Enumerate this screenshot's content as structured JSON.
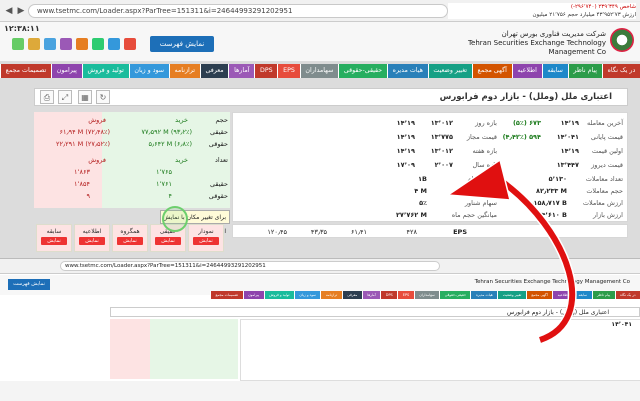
{
  "browser": {
    "url": "www.tsetmc.com/Loader.aspx?ParTree=151311&i=24644993291202951",
    "back_icon": "back-arrow-icon",
    "forward_icon": "forward-arrow-icon"
  },
  "ticker": {
    "line1": "شاخص ۲۳۹٬۳۴۹ (۲۹۶٬۷۴۰-)",
    "line2": "ارزش ۴۳٬۹۵۲٬۷۳ میلیارد  حجم ۲۱٬۷۵۶ میلیون",
    "time": "۱۲:۳۸:۱۱"
  },
  "header": {
    "company_fa": "شرکت مدیریت فناوری بورس تهران",
    "company_en": "Tehran Securities Exchange Technology Management Co",
    "show_list_label": "نمایش فهرست"
  },
  "menu": [
    {
      "label": "در یک نگاه",
      "color": "#c0392b"
    },
    {
      "label": "پیام ناظر",
      "color": "#2c9c4a"
    },
    {
      "label": "سابقه",
      "color": "#1e88c9"
    },
    {
      "label": "اطلاعیه",
      "color": "#8e44ad"
    },
    {
      "label": "آگهی مجمع",
      "color": "#d35400"
    },
    {
      "label": "تغییر وضعیت",
      "color": "#16a085"
    },
    {
      "label": "هیات مدیره",
      "color": "#2980b9"
    },
    {
      "label": "حقیقی-حقوقی",
      "color": "#27ae60"
    },
    {
      "label": "سهامداران",
      "color": "#7f8c8d"
    },
    {
      "label": "EPS",
      "color": "#e74c3c"
    },
    {
      "label": "DPS",
      "color": "#c0392b"
    },
    {
      "label": "آمارها",
      "color": "#9b59b6"
    },
    {
      "label": "معرفی",
      "color": "#2c3e50"
    },
    {
      "label": "ترازنامه",
      "color": "#e67e22"
    },
    {
      "label": "سود و زیان",
      "color": "#3498db"
    },
    {
      "label": "تولید و فروش",
      "color": "#1abc9c"
    },
    {
      "label": "پیرامون",
      "color": "#8e44ad"
    },
    {
      "label": "تصمیمات مجمع",
      "color": "#c0392b"
    }
  ],
  "title": "اعتباری ملل (وملل) - بازار دوم فرابورس",
  "stats_right": [
    {
      "label": "آخرین معامله",
      "value": "۱۴٬۱۹",
      "change": "(۵٪) ۶۷۳"
    },
    {
      "label": "قیمت پایانی",
      "value": "۱۴٬۰۴۱",
      "change": "(۴٫۴۲٪) ۵۹۴"
    },
    {
      "label": "اولین قیمت",
      "value": "۱۴٬۱۹"
    },
    {
      "label": "قیمت دیروز",
      "value": "۱۳٬۴۴۷"
    }
  ],
  "stats_mid": [
    {
      "label": "بازه روز",
      "v1": "۱۳٬۰۱۲",
      "v2": "۱۴٬۱۹"
    },
    {
      "label": "قیمت مجاز",
      "v1": "۱۳٬۷۷۵",
      "v2": "۱۴٬۱۹"
    },
    {
      "label": "بازه هفته",
      "v1": "۱۳٬۰۱۲",
      "v2": "۱۴٬۱۹"
    },
    {
      "label": "بازه سال",
      "v1": "۲٬۰۰۷",
      "v2": "۱۷٬۰۹"
    }
  ],
  "stats_counts": [
    {
      "label": "تعداد معاملات",
      "value": "۵٬۱۳۰"
    },
    {
      "label": "حجم معاملات",
      "value": "۸۲٫۲۳۳ M"
    },
    {
      "label": "ارزش معاملات",
      "value": "۱٫۱۵۸٫۷۱۷ B"
    },
    {
      "label": "ارزش بازار",
      "value": "۲۴٬۶۱۰ B"
    }
  ],
  "stats_shares": [
    {
      "label": "تعداد سهام",
      "value": "۱B"
    },
    {
      "label": "حجم مبنا",
      "value": "۴ M"
    },
    {
      "label": "سهام شناور",
      "value": "۵٪"
    },
    {
      "label": "میانگین حجم ماه",
      "value": "۲۷٬۷۶۲ M"
    }
  ],
  "eps": {
    "label": "EPS",
    "v1": "۴۲۸",
    "v2": "۶۱٫۴۱",
    "v3": "۴۳٫۳۵",
    "v4": "۱۲۰٫۴۵"
  },
  "buysell": {
    "sell_label": "فروش",
    "buy_label": "خرید",
    "volume_label": "حجم",
    "real_label": "حقیقی",
    "legal_label": "حقوقی",
    "row1_sell": "۶۱٫۹۴ M (۷۲٫۴۸٪)",
    "row1_buy": "۷۷٫۵۹۲ M (۹۳٫۲٪)",
    "row2_sell": "۲۲٫۲۹۱ M (۲۷٫۵۲٪)",
    "row2_buy": "۵٫۶۴۲ M (۶٫۸٪)",
    "count_label": "تعداد",
    "count_buy": "۱٬۷۶۵",
    "count_sell": "۱٬۸۶۳",
    "count_buy2": "۱٬۷۶۱",
    "count_sell2": "۱٬۸۵۴",
    "count_buy3": "۴",
    "count_sell3": "۹"
  },
  "tooltip": "برای تغییر مکان با نمایش اطلاعات",
  "bottom_buttons": [
    {
      "label": "سابقه",
      "btn": "نمایش"
    },
    {
      "label": "اطلاعیه",
      "btn": "نمایش"
    },
    {
      "label": "همگروه",
      "btn": "نمایش"
    },
    {
      "label": "حقیقی",
      "btn": "نمایش"
    },
    {
      "label": "نمودار",
      "btn": "نمایش"
    }
  ]
}
